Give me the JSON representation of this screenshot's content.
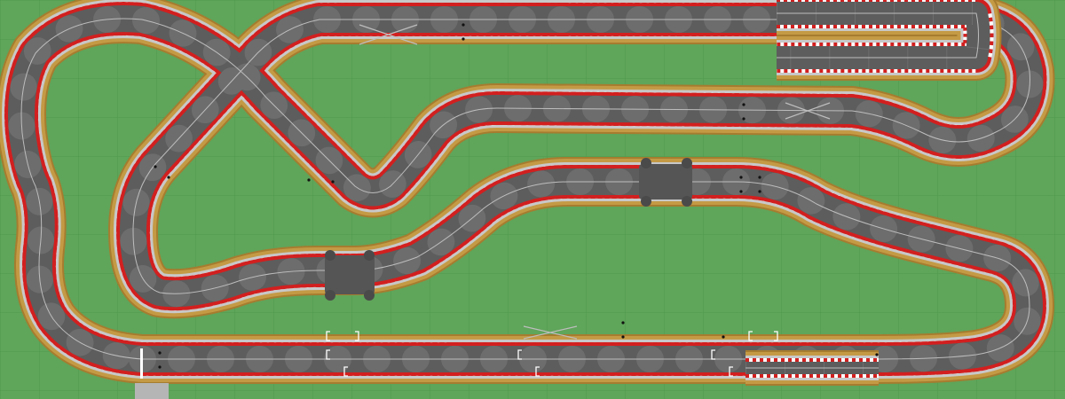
{
  "colors": {
    "grass": "#5fa55a",
    "grid": "#4f9a4c",
    "sand": "#c49a45",
    "sand_edge": "#a67c2f",
    "apron": "#c8c8c8",
    "asphalt": "#5d5d5d",
    "asphalt_seam": "#6f6f6f",
    "lane_line": "#bdbdbd",
    "curb_red": "#d21f1f",
    "curb_white": "#ffffff",
    "bridge": "#555555",
    "pit_box": "#ffffff",
    "start_line": "#ffffff",
    "control_box": "#b5b5b5"
  },
  "icons": [
    "crossover-icon",
    "lane-change-icon",
    "start-finish-line-icon",
    "bridge-pier-icon",
    "pit-box-icon"
  ]
}
